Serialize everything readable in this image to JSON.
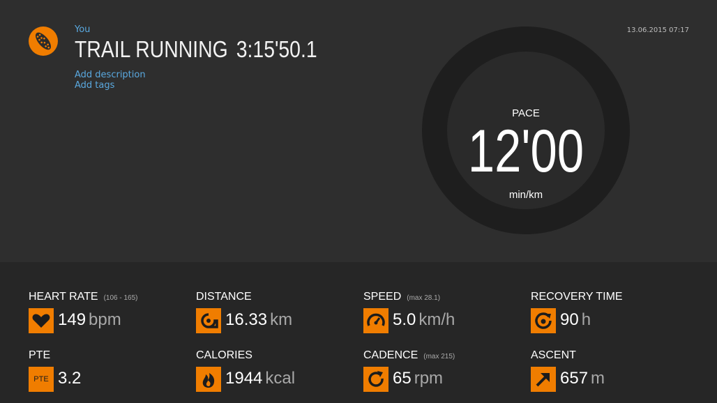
{
  "header": {
    "user": "You",
    "sport": "TRAIL RUNNING",
    "duration": "3:15'50.1",
    "add_description": "Add description",
    "add_tags": "Add tags",
    "date": "13.06.2015 07:17",
    "sport_icon": "shoe-sole-icon"
  },
  "pace": {
    "label": "PACE",
    "value": "12'00",
    "unit": "min/km"
  },
  "stats": {
    "heart_rate": {
      "label": "HEART RATE",
      "sub": "(106 - 165)",
      "value": "149",
      "unit": "bpm",
      "icon": "heart-icon"
    },
    "distance": {
      "label": "DISTANCE",
      "value": "16.33",
      "unit": "km",
      "icon": "measuring-tape-icon"
    },
    "speed": {
      "label": "SPEED",
      "sub": "(max 28.1)",
      "value": "5.0",
      "unit": "km/h",
      "icon": "speedometer-icon"
    },
    "recovery": {
      "label": "RECOVERY TIME",
      "value": "90",
      "unit": "h",
      "icon": "recovery-icon"
    },
    "pte": {
      "label": "PTE",
      "value": "3.2",
      "icon_text": "PTE"
    },
    "calories": {
      "label": "CALORIES",
      "value": "1944",
      "unit": "kcal",
      "icon": "flame-icon"
    },
    "cadence": {
      "label": "CADENCE",
      "sub": "(max 215)",
      "value": "65",
      "unit": "rpm",
      "icon": "cycle-arrow-icon"
    },
    "ascent": {
      "label": "ASCENT",
      "value": "657",
      "unit": "m",
      "icon": "arrow-up-right-icon"
    }
  },
  "colors": {
    "accent": "#f07d00",
    "link": "#5aa9e0",
    "background": "#2e2e2e",
    "stats_background": "#262626"
  }
}
